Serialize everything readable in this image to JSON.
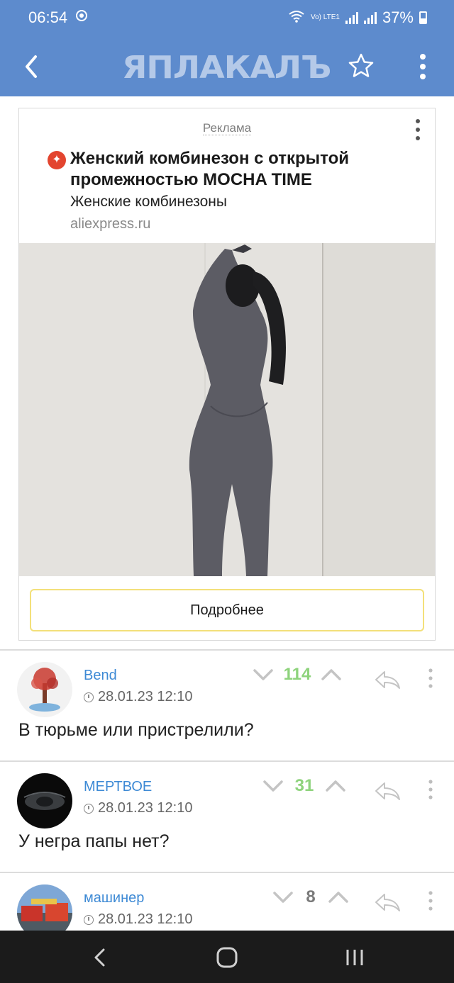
{
  "status_bar": {
    "time": "06:54",
    "network": "Vo) LTE1",
    "battery": "37%"
  },
  "app_bar": {
    "logo": "ЯПЛАКАЛЪ",
    "icons": [
      "back-arrow-icon",
      "star-icon",
      "more-vertical-icon"
    ]
  },
  "ad": {
    "label": "Реклама",
    "title": "Женский комбинезон с открытой промежностью MOCHA TIME",
    "subtitle": "Женские комбинезоны",
    "domain": "aliexpress.ru",
    "button_label": "Подробнее"
  },
  "comments": [
    {
      "user": "Bend",
      "date": "28.01.23 12:10",
      "score": "114",
      "text": "В тюрьме или пристрелили?"
    },
    {
      "user": "МЕРТВОЕ",
      "date": "28.01.23 12:10",
      "score": "31",
      "text": "У негра папы нет?"
    },
    {
      "user": "машинер",
      "date": "28.01.23 12:10",
      "score": "8",
      "text": ""
    }
  ],
  "colors": {
    "app_bar": "#5d8bcd",
    "link": "#3e8ad5",
    "score_positive": "#8ed37c",
    "score_neutral": "#7a7a7a",
    "button_border": "#f3e07a"
  },
  "system_nav": {
    "icons": [
      "nav-back-icon",
      "nav-home-icon",
      "nav-recents-icon"
    ]
  }
}
